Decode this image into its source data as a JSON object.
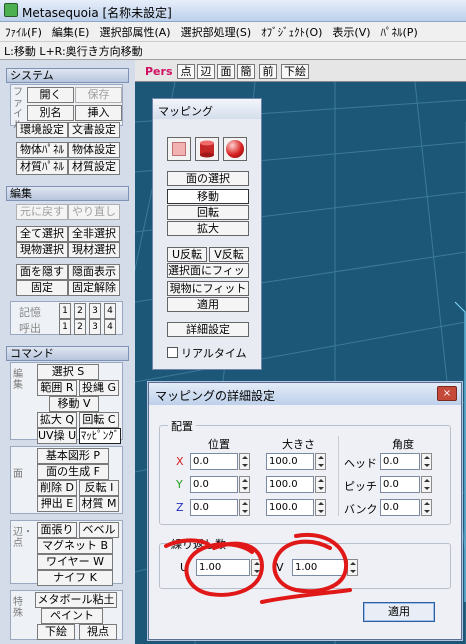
{
  "window": {
    "title": "Metasequoia [名称未設定]"
  },
  "menu": [
    "ﾌｧｲﾙ(F)",
    "編集(E)",
    "選択部属性(A)",
    "選択部処理(S)",
    "ｵﾌﾞｼﾞｪｸﾄ(O)",
    "表示(V)",
    "ﾊﾟﾈﾙ(P)"
  ],
  "hint": "L:移動  L+R:奥行き方向移動",
  "left": {
    "system": {
      "title": "システム",
      "file_label": "ファイル",
      "open": "開く",
      "save": "保存",
      "save_as": "別名",
      "insert": "挿入",
      "env": "環境設定",
      "docs": "文書設定",
      "obj_panel": "物体ﾊﾟﾈﾙ",
      "obj_settings": "物体設定",
      "mat_panel": "材質ﾊﾟﾈﾙ",
      "mat_settings": "材質設定"
    },
    "edit": {
      "title": "編集",
      "undo": "元に戻す",
      "redo": "やり直し",
      "select_all": "全て選択",
      "invert": "全非選択",
      "cur_obj": "現物選択",
      "cur_mat": "現材選択",
      "hide": "面を隠す",
      "show": "隠面表示",
      "lock": "固定",
      "unlock": "固定解除",
      "memory": "記憶",
      "recall": "呼出",
      "slots": [
        "1",
        "2",
        "3",
        "4"
      ]
    },
    "command": {
      "title": "コマンド",
      "edit_label": "編集",
      "face_label": "面",
      "vertex_label": "辺・点",
      "special_label": "特殊",
      "select": "選択 S",
      "range": "範囲 R",
      "lasso": "投縄 G",
      "move": "移動 V",
      "scale": "拡大 Q",
      "rotate": "回転 C",
      "uv": "UV操 U",
      "mapping": "ﾏｯﾋﾟﾝｸﾞ",
      "basic": "基本図形 P",
      "gen_face": "面の生成 F",
      "delete": "削除 D",
      "flip": "反転 I",
      "extrude": "押出 E",
      "material": "材質 M",
      "face_cut": "面張り",
      "bevel": "ベベル",
      "magnet": "マグネット B",
      "wire": "ワイヤー W",
      "knife": "ナイフ K",
      "metaball": "メタボール粘土",
      "paint": "ペイント",
      "sketch": "下絵",
      "viewpoint": "視点"
    }
  },
  "view": {
    "labels": {
      "pers": "Pers",
      "pt": "点",
      "edge": "辺",
      "face": "面",
      "tex": "簡",
      "front": "前",
      "below": "下絵"
    }
  },
  "mapping": {
    "title": "マッピング",
    "select_face": "面の選択",
    "move": "移動",
    "rotate": "回転",
    "scale": "拡大",
    "u_flip": "U反転",
    "v_flip": "V反転",
    "fit_selected": "選択面にフィット",
    "fit_object": "現物にフィット",
    "apply": "適用",
    "details": "詳細設定",
    "realtime": "リアルタイム",
    "realtime_checked": false,
    "shape_colors": {
      "plane": "#f2b2b2",
      "cylinder": "#d03030",
      "sphere": "#d82020"
    }
  },
  "dialog": {
    "title": "マッピングの詳細設定",
    "close_icon": "×",
    "layout_group": "配置",
    "position_header": "位置",
    "size_header": "大きさ",
    "angle_header": "角度",
    "axes": [
      {
        "label": "X",
        "color": "#d02020",
        "pos": "0.0",
        "size": "100.0"
      },
      {
        "label": "Y",
        "color": "#20a020",
        "pos": "0.0",
        "size": "100.0"
      },
      {
        "label": "Z",
        "color": "#2030c0",
        "pos": "0.0",
        "size": "100.0"
      }
    ],
    "angles": [
      {
        "label": "ヘッド",
        "value": "0.0"
      },
      {
        "label": "ピッチ",
        "value": "0.0"
      },
      {
        "label": "バンク",
        "value": "0.0"
      }
    ],
    "repeat_group": "繰り返し数",
    "u_label": "U",
    "u_value": "1.00",
    "v_label": "V",
    "v_value": "1.00",
    "apply": "適用"
  },
  "colors": {
    "annotation": "#e01818",
    "viewport_bg": "#1d5777",
    "grid_line": "#3a7a99"
  }
}
